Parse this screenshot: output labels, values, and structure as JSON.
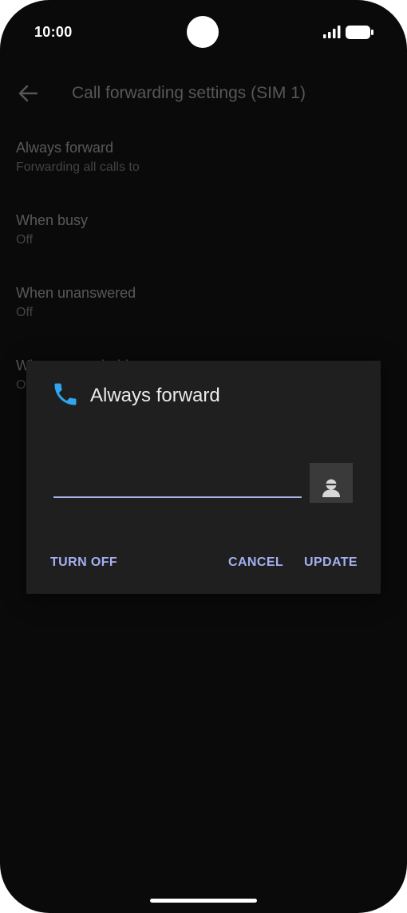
{
  "status_bar": {
    "time": "10:00"
  },
  "appbar": {
    "title": "Call forwarding settings (SIM 1)",
    "back_icon": "arrow-back-icon"
  },
  "settings": [
    {
      "title": "Always forward",
      "summary": "Forwarding all calls to"
    },
    {
      "title": "When busy",
      "summary": "Off"
    },
    {
      "title": "When unanswered",
      "summary": "Off"
    },
    {
      "title": "When unreachable",
      "summary": "Off"
    }
  ],
  "dialog": {
    "icon": "phone-icon",
    "title": "Always forward",
    "input_value": "",
    "contact_icon": "contact-icon",
    "turn_off_label": "TURN OFF",
    "cancel_label": "CANCEL",
    "update_label": "UPDATE"
  },
  "colors": {
    "accent": "#a3b0f2",
    "phone_icon": "#2fa6ee",
    "dialog_bg": "#1f1f1f",
    "screen_bg": "#0a0a0a"
  }
}
